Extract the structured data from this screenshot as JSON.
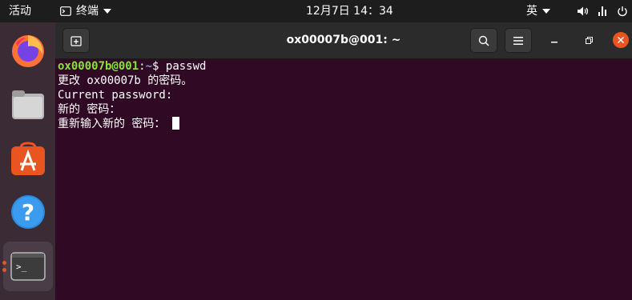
{
  "topbar": {
    "activities": "活动",
    "app_menu_label": "终端",
    "clock": "12月7日  14：34",
    "ime_label": "英"
  },
  "window": {
    "title": "ox00007b@001: ~"
  },
  "terminal": {
    "prompt_user_host": "ox00007b@001",
    "prompt_separator": ":",
    "prompt_path": "~",
    "prompt_symbol": "$ ",
    "command": "passwd",
    "lines": [
      "更改 ox00007b 的密码。",
      "Current password:",
      "新的 密码：",
      "重新输入新的 密码："
    ]
  },
  "dock": {
    "items": [
      "firefox-icon",
      "files-icon",
      "software-icon",
      "help-icon",
      "terminal-icon"
    ]
  },
  "colors": {
    "terminal_bg": "#300a24",
    "prompt_user": "#8ae234",
    "prompt_path": "#729fcf",
    "accent": "#e95420"
  }
}
